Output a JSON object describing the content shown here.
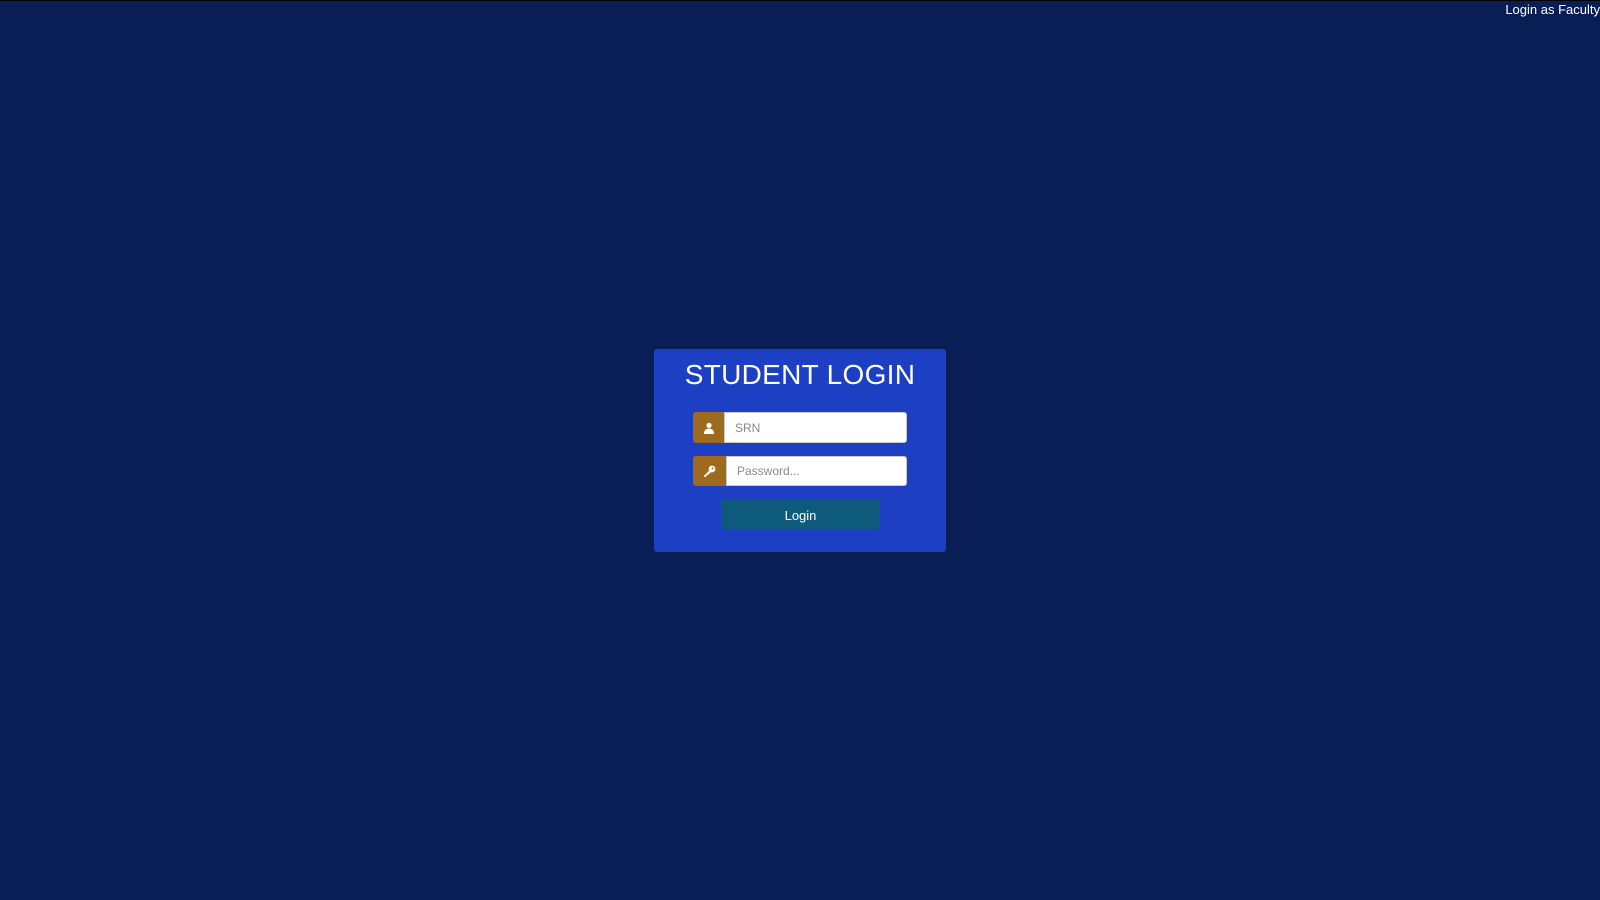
{
  "header": {
    "faculty_link": "Login as Faculty"
  },
  "login": {
    "title": "STUDENT LOGIN",
    "srn": {
      "placeholder": "SRN",
      "value": "",
      "icon": "user-icon"
    },
    "password": {
      "placeholder": "Password...",
      "value": "",
      "icon": "key-icon"
    },
    "submit_label": "Login"
  },
  "colors": {
    "background": "#081e54",
    "card": "#1c3fc4",
    "icon_box": "#9e6a1e",
    "button": "#0d5a7c"
  }
}
